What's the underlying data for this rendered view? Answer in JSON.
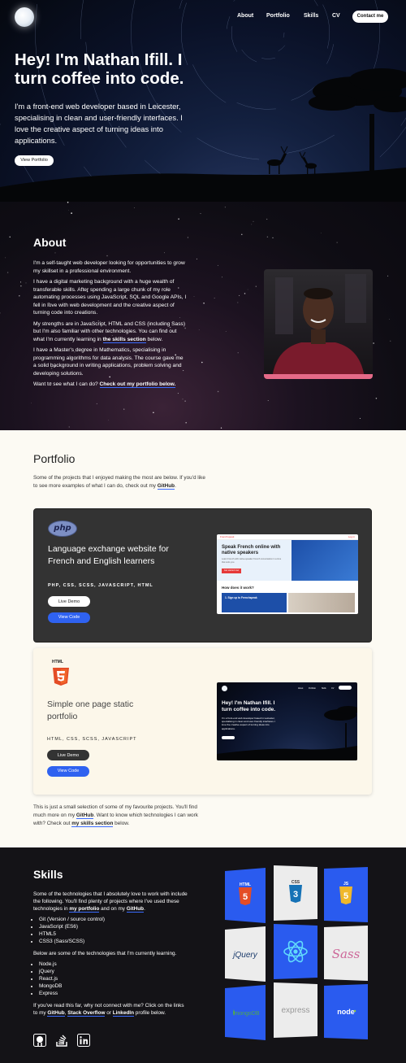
{
  "nav": {
    "items": [
      "About",
      "Portfolio",
      "Skills",
      "CV"
    ],
    "contact_label": "Contact me"
  },
  "hero": {
    "title": "Hey! I'm Nathan Ifill. I turn coffee into code.",
    "text": "I'm a front-end web developer based in Leicester, specialising in clean and user-friendly interfaces. I love the creative aspect of turning ideas into applications.",
    "button": "View Portfolio"
  },
  "about": {
    "heading": "About",
    "p1": "I'm a self-taught web developer looking for opportunities to grow my skillset in a professional environment.",
    "p2": "I have a digital marketing background with a huge wealth of transferable skills. After spending a large chunk of my role automating processes using JavaScript, SQL and Google APIs, I fell in love with web development and the creative aspect of turning code into creations.",
    "p3_pre": "My strengths are in JavaScript, HTML and CSS (including Sass) but I'm also familiar with other technologies. You can find out what I'm currently learning in ",
    "p3_link": "the skills section",
    "p3_post": " below.",
    "p4": "I have a Master's degree in Mathematics, specialising in programming algorithms for data analysis. The course gave me a solid background in writing applications, problem solving and developing solutions.",
    "p5_pre": "Want to see what I can do? ",
    "p5_link": "Check out my portfolio below."
  },
  "portfolio": {
    "heading": "Portfolio",
    "intro_pre": "Some of the projects that I enjoyed making the most are below. If you'd like to see more examples of what I can do, check out my ",
    "intro_link": "GitHub",
    "intro_post": ".",
    "projects": [
      {
        "logo_text": "php",
        "title": "Language exchange website for French and English learners",
        "tags": "PHP, CSS, SCSS, JAVASCRIPT, HTML",
        "demo": "Live Demo",
        "code": "View Code",
        "shot": {
          "brand": "Frenchspeak",
          "account": "Log in",
          "title": "Speak French online with native speakers",
          "subtitle": "Learn French with native-speaker French conversation in a time that suits you.",
          "button": "Get started now",
          "how": "How does it work?",
          "step": "1. Sign up to Frenchspeak"
        }
      },
      {
        "logo_text": "HTML",
        "title": "Simple one page static portfolio",
        "tags": "HTML, CSS, SCSS, JAVASCRIPT",
        "demo": "Live Demo",
        "code": "View Code",
        "shot": {
          "title": "Hey! I'm Nathan Ifill. I turn coffee into code.",
          "text": "I'm a front-end web developer based in Leicester, specialising in clean and user-friendly interfaces. I love the creative aspect of turning ideas into applications."
        }
      }
    ],
    "outro_pre": "This is just a small selection of some of my favourite projects. You'll find much more on my ",
    "outro_link1": "GitHub",
    "outro_mid": ". Want to know which technologies I can work with? Check out ",
    "outro_link2": "my skills section",
    "outro_post": " below."
  },
  "skills": {
    "heading": "Skills",
    "p1_pre": "Some of the technologies that I absolutely love to work with include the following. You'll find plenty of projects where I've used these technologies in ",
    "p1_link1": "my portfolio",
    "p1_mid": " and on my ",
    "p1_link2": "GitHub",
    "p1_post": ".",
    "love": [
      "Git (Version / source control)",
      "JavaScript (ES6)",
      "HTML5",
      "CSS3 (Sass/SCSS)"
    ],
    "p2": "Below are some of the technologies that I'm currently learning.",
    "learning": [
      "Node.js",
      "jQuery",
      "React.js",
      "MongoDB",
      "Express"
    ],
    "p3_pre": "If you've read this far, why not connect with me? Click on the links to my ",
    "p3_link1": "GitHub",
    "p3_sep1": ", ",
    "p3_link2": "Stack Overflow",
    "p3_sep2": " or ",
    "p3_link3": "LinkedIn",
    "p3_post": " profile below.",
    "tiles": [
      {
        "label": "HTML",
        "icon": "html5-icon"
      },
      {
        "label": "CSS",
        "icon": "css3-icon"
      },
      {
        "label": "JS",
        "icon": "javascript-icon"
      },
      {
        "label": "jQuery",
        "icon": "jquery-icon"
      },
      {
        "label": "",
        "icon": "react-icon"
      },
      {
        "label": "Sass",
        "icon": "sass-icon"
      },
      {
        "label": "mongoDB",
        "icon": "mongodb-icon"
      },
      {
        "label": "express",
        "icon": "express-icon"
      },
      {
        "label": "node",
        "icon": "nodejs-icon"
      }
    ]
  },
  "colors": {
    "accent_blue": "#2f62f0",
    "portrait_bar": "#e56a88",
    "portfolio_bg": "#fcfaf3",
    "skills_bg": "#141317"
  }
}
